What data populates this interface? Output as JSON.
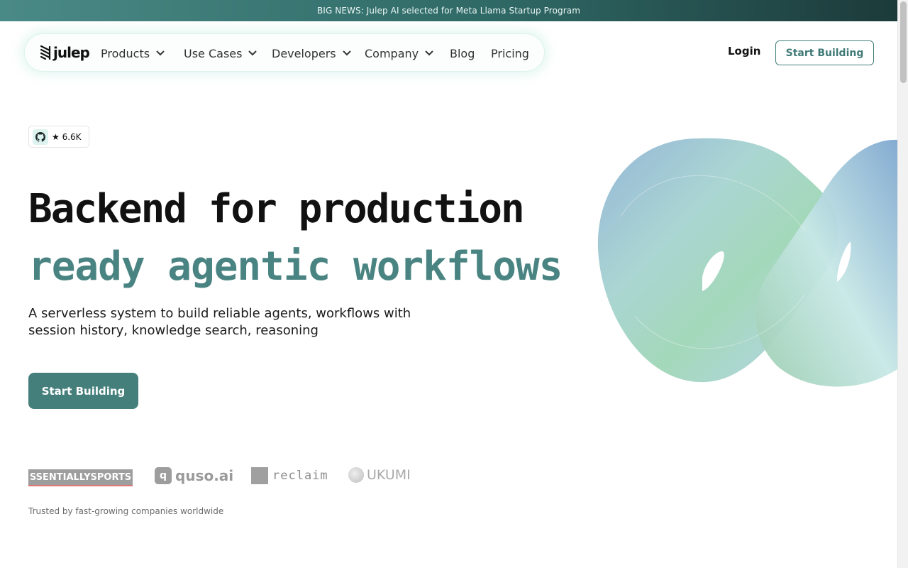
{
  "banner": {
    "text": "BIG NEWS: Julep AI selected for Meta Llama Startup Program"
  },
  "brand": {
    "name": "julep",
    "accent": "#457f7c"
  },
  "nav": {
    "items": [
      {
        "label": "Products",
        "dropdown": true
      },
      {
        "label": "Use Cases",
        "dropdown": true
      },
      {
        "label": "Developers",
        "dropdown": true
      },
      {
        "label": "Company",
        "dropdown": true
      },
      {
        "label": "Blog",
        "dropdown": false
      },
      {
        "label": "Pricing",
        "dropdown": false
      }
    ],
    "login": "Login",
    "cta": "Start Building"
  },
  "github": {
    "stars": "★ 6.6K",
    "icon": "github-icon"
  },
  "hero": {
    "title_line1": "Backend for production",
    "title_line2": "ready agentic workflows",
    "subtitle": "A serverless system to build reliable agents, workflows with session history, knowledge search, reasoning",
    "cta": "Start Building"
  },
  "logos": {
    "essentiallysports": "SSENTIALLYSPORTS",
    "quso": "quso.ai",
    "quso_mark": "q",
    "reclaim": "reclaim",
    "ukumi": "UKUMI"
  },
  "trusted": "Trusted by fast-growing companies worldwide"
}
